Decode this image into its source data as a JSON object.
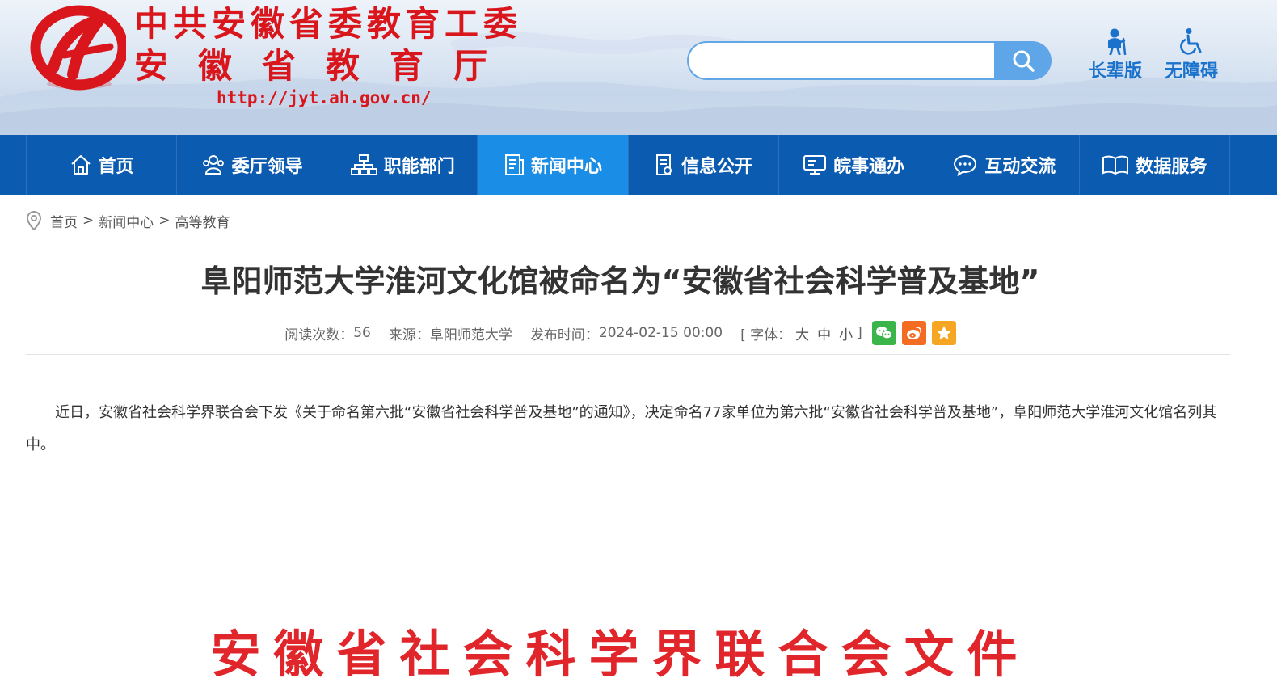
{
  "header": {
    "site_name_line1": "中共安徽省委教育工委",
    "site_name_line2": "安徽省教育厅",
    "site_url": "http://jyt.ah.gov.cn/",
    "search": {
      "placeholder": "",
      "value": ""
    },
    "tools": [
      {
        "label": "长辈版",
        "icon": "elder-person-icon"
      },
      {
        "label": "无障碍",
        "icon": "wheelchair-icon"
      }
    ]
  },
  "nav": {
    "items": [
      {
        "label": "首页",
        "icon": "home-icon"
      },
      {
        "label": "委厅领导",
        "icon": "leaders-icon"
      },
      {
        "label": "职能部门",
        "icon": "org-chart-icon"
      },
      {
        "label": "新闻中心",
        "icon": "news-document-icon",
        "active": true
      },
      {
        "label": "信息公开",
        "icon": "info-document-icon"
      },
      {
        "label": "皖事通办",
        "icon": "monitor-icon"
      },
      {
        "label": "互动交流",
        "icon": "chat-bubble-icon"
      },
      {
        "label": "数据服务",
        "icon": "open-book-icon"
      }
    ]
  },
  "breadcrumb": {
    "icon": "location-pin-icon",
    "items": [
      "首页",
      "新闻中心",
      "高等教育"
    ],
    "separator": ">"
  },
  "article": {
    "title": "阜阳师范大学淮河文化馆被命名为“安徽省社会科学普及基地”",
    "meta": {
      "views_label": "阅读次数：",
      "views": "56",
      "source_label": "来源：",
      "source": "阜阳师范大学",
      "published_label": "发布时间：",
      "published": "2024-02-15 00:00",
      "font_label": "[ 字体：",
      "font_sizes": [
        "大",
        "中",
        "小"
      ],
      "font_close": "]"
    },
    "share": [
      "wechat-icon",
      "weibo-icon",
      "favorite-star-icon"
    ],
    "body": "近日，安徽省社会科学界联合会下发《关于命名第六批“安徽省社会科学普及基地”的通知》，决定命名77家单位为第六批“安徽省社会科学普及基地”，阜阳师范大学淮河文化馆名列其中。",
    "document_image_heading": "安徽省社会科学界联合会文件"
  },
  "colors": {
    "brand_red": "#d9161c",
    "nav_blue": "#0b5bb1",
    "nav_active": "#1a8de6",
    "accent_blue": "#1a72cc"
  }
}
